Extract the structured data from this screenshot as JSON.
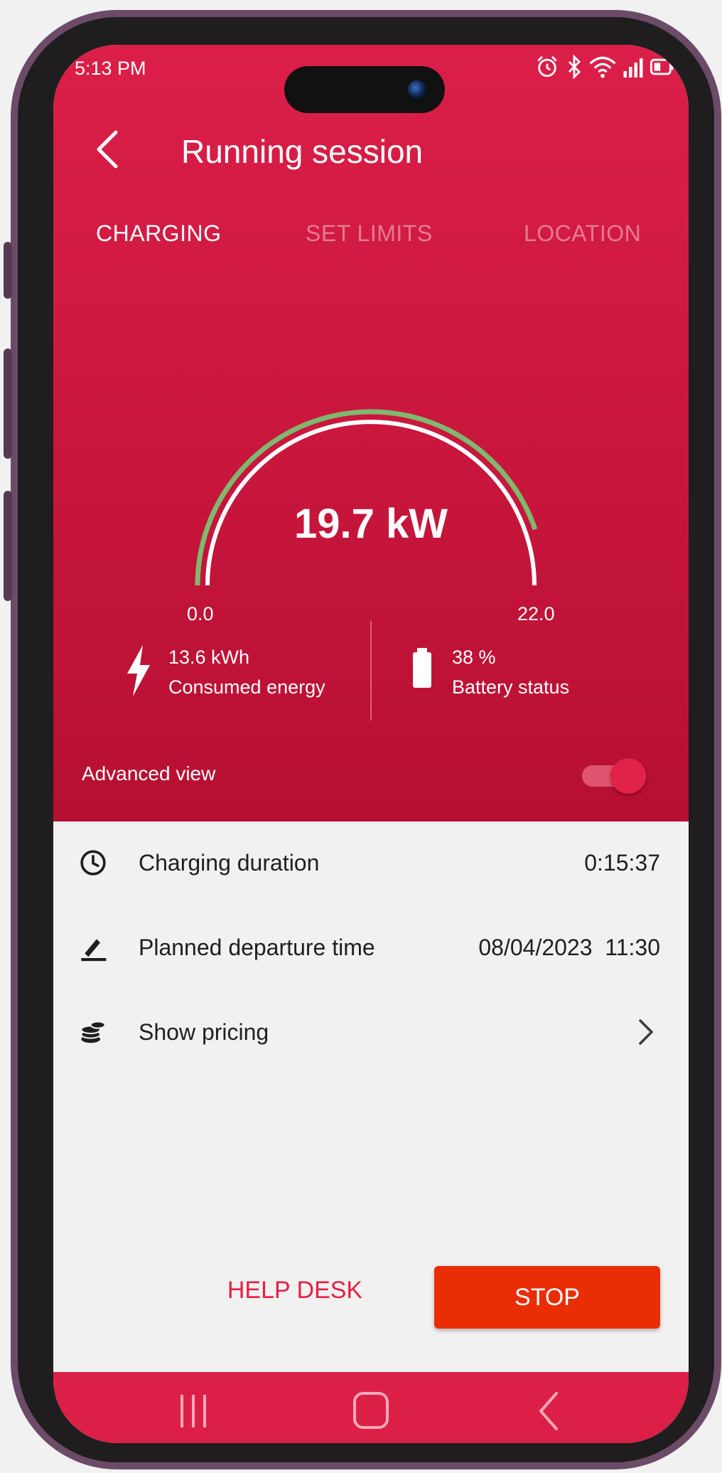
{
  "status_bar": {
    "time": "5:13 PM",
    "icons": [
      "alarm-icon",
      "bluetooth-icon",
      "wifi-icon",
      "signal-icon",
      "battery-icon"
    ]
  },
  "header": {
    "title": "Running session",
    "back_icon": "chevron-left-icon"
  },
  "tabs": [
    {
      "label": "CHARGING",
      "active": true
    },
    {
      "label": "SET LIMITS",
      "active": false
    },
    {
      "label": "LOCATION",
      "active": false
    }
  ],
  "gauge": {
    "value_label": "19.7 kW",
    "min_label": "0.0",
    "max_label": "22.0",
    "min": 0,
    "max": 22,
    "value": 19.7,
    "arc_color": "#7fb86e",
    "track_color": "#ffffff"
  },
  "stats": {
    "energy": {
      "value": "13.6 kWh",
      "label": "Consumed energy",
      "icon": "lightning-bolt-icon"
    },
    "battery": {
      "value": "38 %",
      "label": "Battery status",
      "icon": "battery-icon"
    }
  },
  "advanced_view": {
    "label": "Advanced view",
    "enabled": true
  },
  "details": [
    {
      "icon": "clock-icon",
      "label": "Charging duration",
      "value": "0:15:37"
    },
    {
      "icon": "pencil-icon",
      "label": "Planned departure time",
      "value": "08/04/2023  11:30"
    },
    {
      "icon": "coins-icon",
      "label": "Show pricing",
      "value": ""
    }
  ],
  "actions": {
    "help_desk": "HELP DESK",
    "stop": "STOP"
  },
  "colors": {
    "brand": "#dc1f47",
    "stop_button": "#e92d05",
    "help_desk_text": "#e32145"
  },
  "nav_bar": {
    "icons": [
      "recent-apps-icon",
      "home-icon",
      "back-icon"
    ]
  }
}
